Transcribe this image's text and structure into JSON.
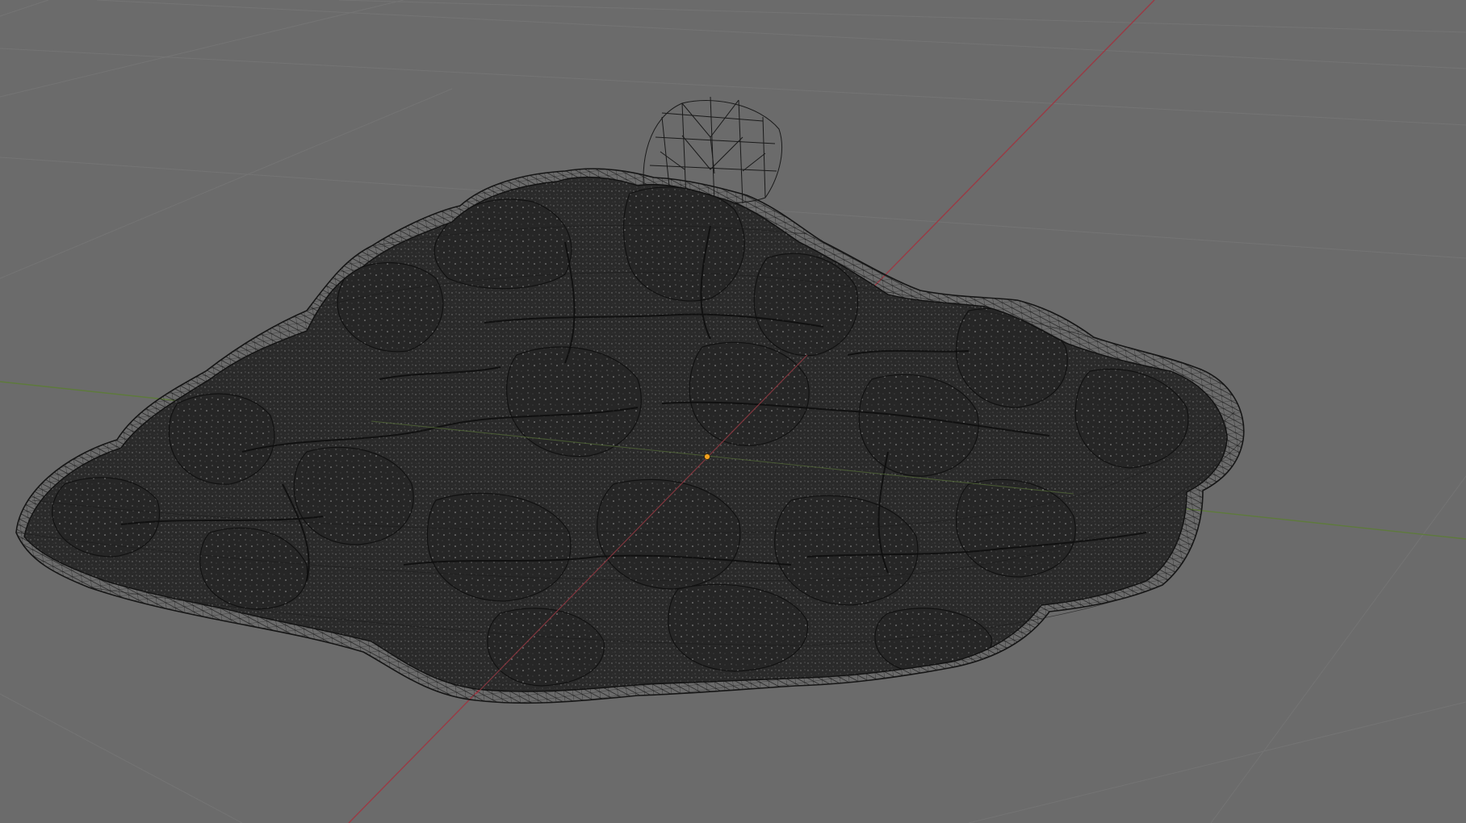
{
  "app": {
    "name": "3D viewport",
    "view_mode": "wireframe"
  },
  "colors": {
    "background": "#6b6b6b",
    "grid_line": "#747474",
    "x_axis": "#9a3a44",
    "y_axis": "#5e7a3c",
    "mesh_fill": "#2b2b2b",
    "mesh_wire": "#141414",
    "origin_dot": "#f0a020"
  },
  "scene": {
    "objects": [
      {
        "name_icon": "rock-scan-mesh-icon",
        "kind": "dense scanned rock mesh"
      },
      {
        "name_icon": "proxy-hull-wireframe-icon",
        "kind": "low-poly convex wire hull"
      },
      {
        "name_icon": "sphere-wireframe-icon",
        "kind": "small wire sphere"
      }
    ],
    "origin_marker": "origin-dot"
  }
}
